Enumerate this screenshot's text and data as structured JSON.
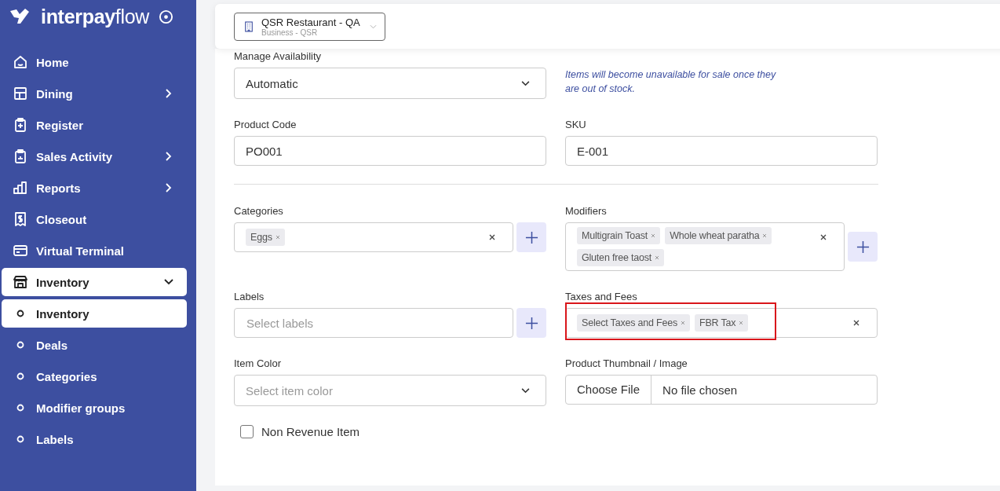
{
  "sidebar": {
    "logo": "**interpay**flow",
    "items": [
      {
        "label": "Home",
        "has_children": false,
        "expanded": false
      },
      {
        "label": "Dining",
        "has_children": true,
        "expanded": false
      },
      {
        "label": "Register",
        "has_children": false,
        "expanded": false
      },
      {
        "label": "Sales Activity",
        "has_children": true,
        "expanded": false
      },
      {
        "label": "Reports",
        "has_children": true,
        "expanded": false
      },
      {
        "label": "Closeout",
        "has_children": false,
        "expanded": false
      },
      {
        "label": "Virtual Terminal",
        "has_children": false,
        "expanded": false
      },
      {
        "label": "Inventory",
        "has_children": true,
        "expanded": true,
        "children": [
          {
            "label": "Inventory",
            "selected": true
          },
          {
            "label": "Deals",
            "selected": false
          },
          {
            "label": "Categories",
            "selected": false
          },
          {
            "label": "Modifier groups",
            "selected": false
          },
          {
            "label": "Labels",
            "selected": false
          }
        ]
      }
    ]
  },
  "business": {
    "name": "QSR Restaurant - QA",
    "subtitle": "Business - QSR"
  },
  "form": {
    "sections": [
      {
        "rows": [
          {
            "fields": [
              {
                "kind": "select",
                "label": "Manage Availability",
                "value": "Automatic"
              },
              {
                "kind": "note",
                "text": "Items will become unavailable for sale once they are out of stock."
              }
            ]
          },
          {
            "fields": [
              {
                "kind": "text",
                "label": "Product Code",
                "value": "PO001"
              },
              {
                "kind": "text",
                "label": "SKU",
                "value": "E-001"
              }
            ]
          }
        ]
      },
      {
        "rows": [
          {
            "fields": [
              {
                "kind": "multiselect",
                "label": "Categories",
                "tags": [
                  "Eggs"
                ],
                "add_button": true,
                "highlighted": false
              },
              {
                "kind": "multiselect",
                "label": "Modifiers",
                "tags": [
                  "Multigrain Toast",
                  "Whole wheat paratha",
                  "Gluten free taost"
                ],
                "add_button": true,
                "highlighted": false
              }
            ]
          },
          {
            "fields": [
              {
                "kind": "multiselect",
                "label": "Labels",
                "placeholder": "Select labels",
                "add_button": true,
                "highlighted": false
              },
              {
                "kind": "multiselect",
                "label": "Taxes and Fees",
                "tags": [
                  "Select Taxes and Fees",
                  "FBR Tax"
                ],
                "add_button": false,
                "highlighted": true
              }
            ]
          },
          {
            "fields": [
              {
                "kind": "select",
                "label": "Item Color",
                "placeholder": "Select item color"
              },
              {
                "kind": "file",
                "label": "Product Thumbnail / Image",
                "button": "Choose File",
                "status": "No file chosen"
              }
            ]
          }
        ]
      }
    ],
    "checkbox": {
      "label": "Non Revenue Item",
      "checked": false
    }
  }
}
